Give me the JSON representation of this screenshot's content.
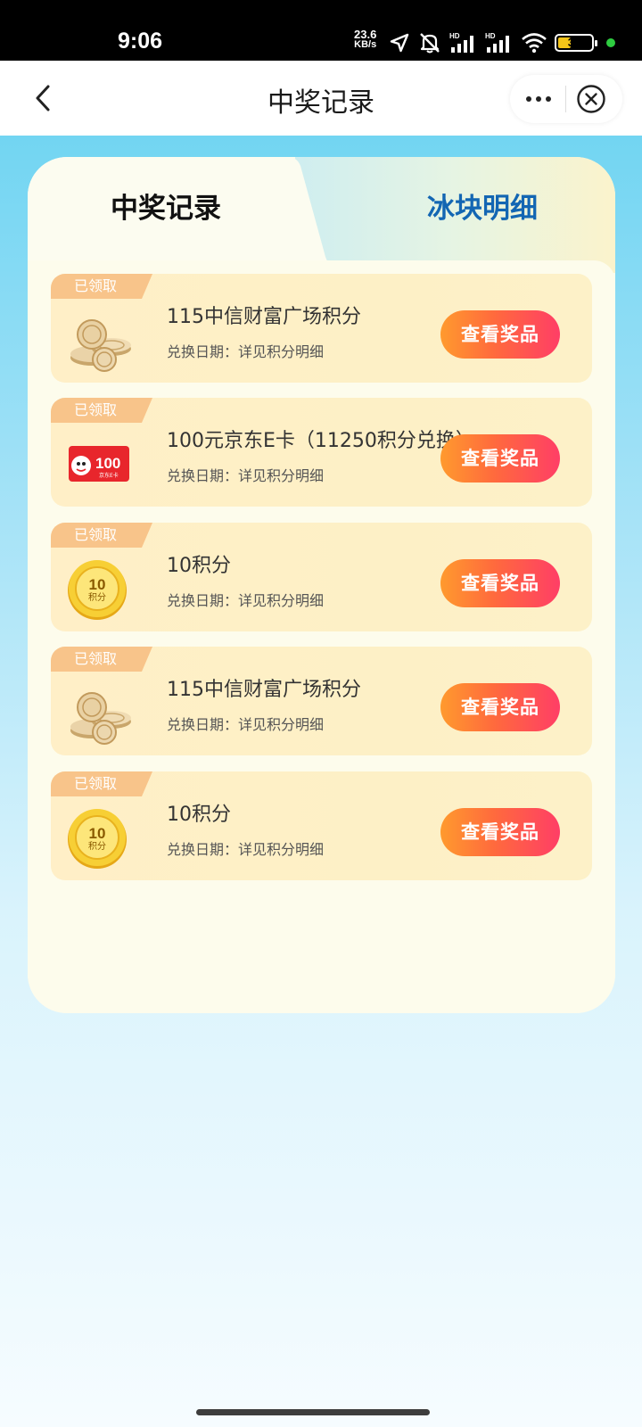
{
  "status_bar": {
    "time": "9:06",
    "net_speed_value": "23.6",
    "net_speed_unit": "KB/s",
    "battery": "39",
    "battery_level": 0.39
  },
  "nav": {
    "title": "中奖记录"
  },
  "tabs": [
    {
      "label": "中奖记录",
      "active": true
    },
    {
      "label": "冰块明细",
      "active": false
    }
  ],
  "records": [
    {
      "badge": "已领取",
      "icon": "coin-stack-icon",
      "title": "115中信财富广场积分",
      "date": "兑换日期：详见积分明细",
      "button": "查看奖品"
    },
    {
      "badge": "已领取",
      "icon": "jd-ecard-icon",
      "icon_text": "100",
      "icon_subtext": "京东E卡",
      "title": "100元京东E卡（11250积分兑换）",
      "date": "兑换日期：详见积分明细",
      "button": "查看奖品"
    },
    {
      "badge": "已领取",
      "icon": "gold-points-coin-icon",
      "icon_text": "10",
      "icon_subtext": "积分",
      "title": "10积分",
      "date": "兑换日期：详见积分明细",
      "button": "查看奖品"
    },
    {
      "badge": "已领取",
      "icon": "coin-stack-icon",
      "title": "115中信财富广场积分",
      "date": "兑换日期：详见积分明细",
      "button": "查看奖品"
    },
    {
      "badge": "已领取",
      "icon": "gold-points-coin-icon",
      "icon_text": "10",
      "icon_subtext": "积分",
      "title": "10积分",
      "date": "兑换日期：详见积分明细",
      "button": "查看奖品"
    }
  ],
  "colors": {
    "accent_button_start": "#ff9a2e",
    "accent_button_end": "#ff3e66",
    "inactive_tab_text": "#1366b3",
    "background_top": "#72d5f2"
  }
}
